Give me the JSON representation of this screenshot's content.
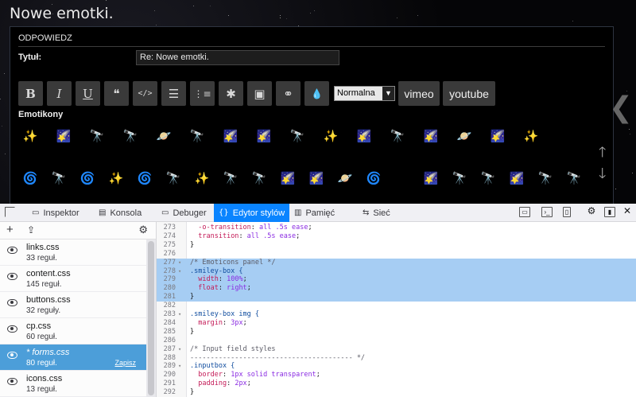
{
  "page": {
    "title": "Nowe emotki."
  },
  "reply": {
    "header": "ODPOWIEDZ",
    "title_label": "Tytuł:",
    "title_value": "Re: Nowe emotki.",
    "toolbar": {
      "bold": "B",
      "italic": "I",
      "underline": "U",
      "quote": "❝",
      "code": "</>",
      "list": "☰",
      "numbered_list": "⋮≡",
      "asterisk": "✱",
      "image": "▣",
      "link": "⚭",
      "color": "💧",
      "size_select": "Normalna",
      "vimeo": "vimeo",
      "youtube": "youtube"
    },
    "emoticons_label": "Emotikony",
    "emoticons_row1": [
      "✨",
      "🌠",
      "🔭",
      "🔭",
      "🪐",
      "🔭",
      "🌠",
      "🌠",
      "🔭",
      "✨",
      "🌠",
      "🔭",
      "🌠",
      "🪐",
      "🌠",
      "✨",
      "☄"
    ],
    "emoticons_row2": [
      "🌀",
      "🔭",
      "🌀",
      "✨",
      "🌀",
      "🔭",
      "✨",
      "🔭",
      "🔭",
      "🌠",
      "🌠",
      "🪐",
      "🌀",
      "😎",
      "🌠",
      "🔭",
      "🔭",
      "🌠",
      "🔭",
      "🔭"
    ]
  },
  "devtools": {
    "tabs": [
      {
        "label": "Inspektor",
        "icon": "inspector-icon"
      },
      {
        "label": "Konsola",
        "icon": "console-icon"
      },
      {
        "label": "Debuger",
        "icon": "debugger-icon"
      },
      {
        "label": "Edytor stylów",
        "icon": "style-editor-icon"
      },
      {
        "label": "Pamięć",
        "icon": "memory-icon"
      },
      {
        "label": "Sieć",
        "icon": "network-icon"
      }
    ],
    "active_tab": "Edytor stylów",
    "stylesheets": [
      {
        "name": "links.css",
        "rules": "33 reguł."
      },
      {
        "name": "content.css",
        "rules": "145 reguł."
      },
      {
        "name": "buttons.css",
        "rules": "32 reguły."
      },
      {
        "name": "cp.css",
        "rules": "60 reguł."
      },
      {
        "name": "* forms.css",
        "rules": "80 reguł.",
        "save": "Zapisz"
      },
      {
        "name": "icons.css",
        "rules": "13 reguł."
      }
    ],
    "code_lines": [
      {
        "n": "273",
        "text": "  -o-transition: all .5s ease;"
      },
      {
        "n": "274",
        "text": "  transition: all .5s ease;"
      },
      {
        "n": "275",
        "text": "}"
      },
      {
        "n": "276",
        "text": ""
      },
      {
        "n": "277",
        "text": "/* Emoticons panel */"
      },
      {
        "n": "278",
        "text": ".smiley-box {"
      },
      {
        "n": "279",
        "text": "  width: 100%;"
      },
      {
        "n": "280",
        "text": "  float: right;"
      },
      {
        "n": "281",
        "text": "}"
      },
      {
        "n": "282",
        "text": ""
      },
      {
        "n": "283",
        "text": ".smiley-box img {"
      },
      {
        "n": "284",
        "text": "  margin: 3px;"
      },
      {
        "n": "285",
        "text": "}"
      },
      {
        "n": "286",
        "text": ""
      },
      {
        "n": "287",
        "text": "/* Input field styles"
      },
      {
        "n": "288",
        "text": "---------------------------------------- */"
      },
      {
        "n": "289",
        "text": ".inputbox {"
      },
      {
        "n": "290",
        "text": "  border: 1px solid transparent;"
      },
      {
        "n": "291",
        "text": "  padding: 2px;"
      },
      {
        "n": "292",
        "text": "}"
      }
    ]
  },
  "colors": {
    "devtools_accent": "#0a84ff",
    "selected_sheet": "#4c9ed9",
    "highlight": "#a6cdf3"
  }
}
